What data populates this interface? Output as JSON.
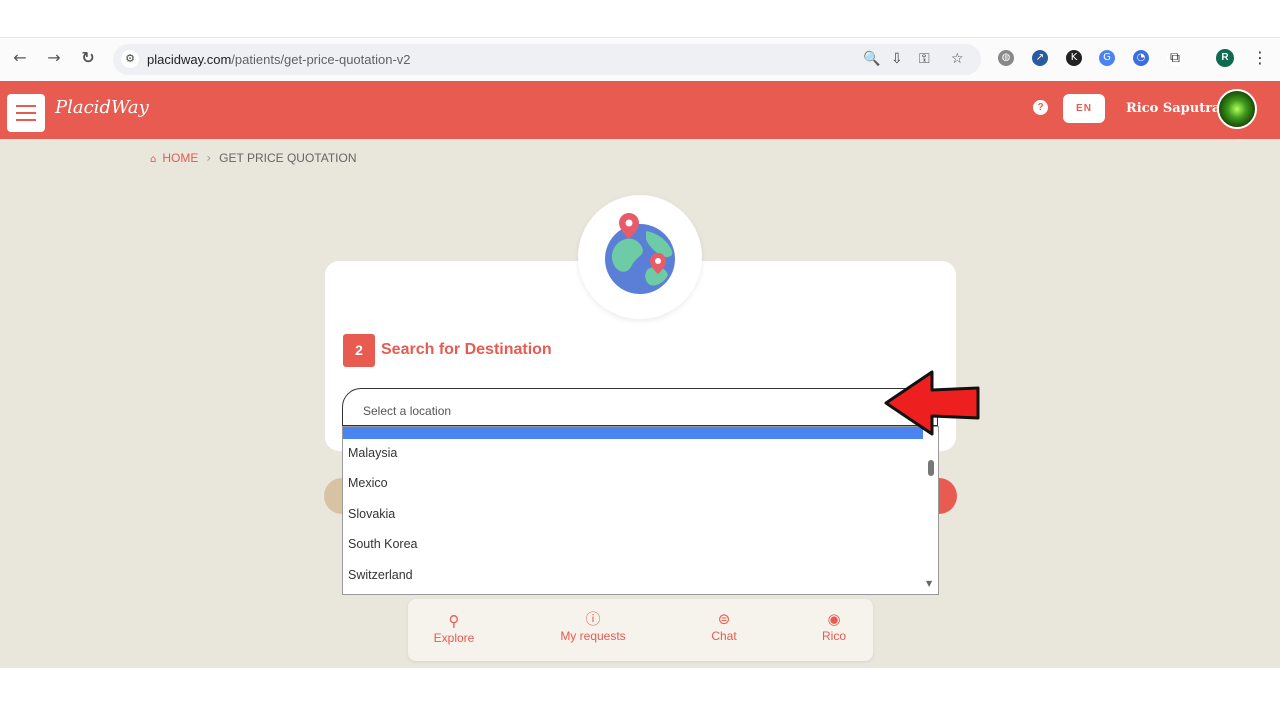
{
  "browser": {
    "url_domain": "placidway.com",
    "url_path": "/patients/get-price-quotation-v2",
    "profile_initial": "R"
  },
  "header": {
    "logo_text": "PlacidWay",
    "help_label": "?",
    "lang": "EN",
    "user_name": "Rico Saputra"
  },
  "breadcrumb": {
    "home": "HOME",
    "current": "GET PRICE QUOTATION"
  },
  "step": {
    "number": "2",
    "title": "Search for Destination"
  },
  "search": {
    "placeholder": "Select a location"
  },
  "dropdown": {
    "options": [
      "Malaysia",
      "Mexico",
      "Slovakia",
      "South Korea",
      "Switzerland"
    ]
  },
  "bottom_nav": {
    "explore": "Explore",
    "my_requests": "My requests",
    "chat": "Chat",
    "profile": "Rico"
  },
  "colors": {
    "brand": "#e85b50",
    "background": "#e9e6dc",
    "highlight": "#4a84f0"
  }
}
